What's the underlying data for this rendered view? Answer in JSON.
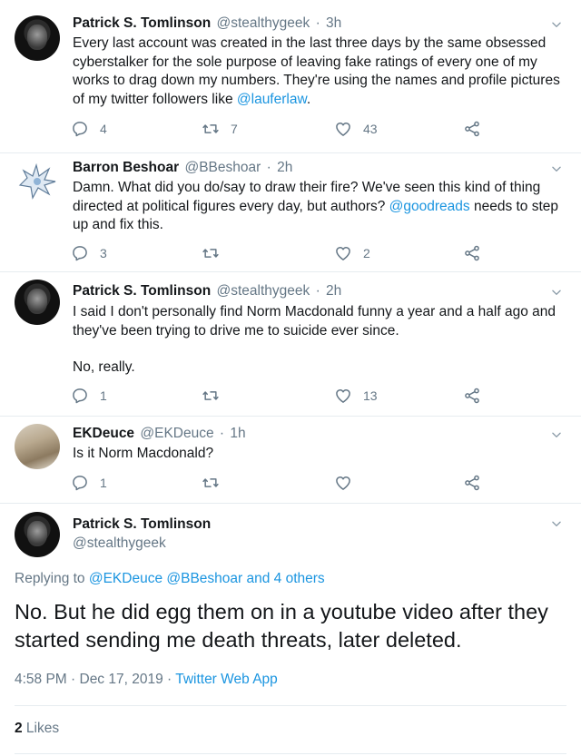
{
  "tweets": [
    {
      "name": "Patrick S. Tomlinson",
      "handle": "@stealthygeek",
      "time": "3h",
      "text_before": "Every last account was created in the last three days by the same obsessed cyberstalker for the sole purpose of leaving fake ratings of every one of my works to drag down my numbers. They're using the names and profile pictures of my twitter followers like ",
      "mention": "@lauferlaw",
      "text_after": ".",
      "replies": "4",
      "retweets": "7",
      "likes": "43"
    },
    {
      "name": "Barron Beshoar",
      "handle": "@BBeshoar",
      "time": "2h",
      "text_before": "Damn. What did you do/say to draw their fire? We've seen this kind of thing directed at political figures every day, but authors? ",
      "mention": "@goodreads",
      "text_after": " needs to step up and fix this.",
      "replies": "3",
      "retweets": "",
      "likes": "2"
    },
    {
      "name": "Patrick S. Tomlinson",
      "handle": "@stealthygeek",
      "time": "2h",
      "text_line1": "I said I don't personally find Norm Macdonald funny a year and a half ago and they've been trying to drive me to suicide ever since.",
      "text_line2": "No, really.",
      "replies": "1",
      "retweets": "",
      "likes": "13"
    },
    {
      "name": "EKDeuce",
      "handle": "@EKDeuce",
      "time": "1h",
      "text": "Is it Norm Macdonald?",
      "replies": "1",
      "retweets": "",
      "likes": ""
    }
  ],
  "main_tweet": {
    "name": "Patrick S. Tomlinson",
    "handle": "@stealthygeek",
    "replying_label": "Replying to",
    "replying_to": "@EKDeuce @BBeshoar and 4 others",
    "text": "No. But he did egg them on in a youtube video after they started sending me death threats, later deleted.",
    "timestamp": "4:58 PM · Dec 17, 2019 · ",
    "source": "Twitter Web App",
    "likes_count": "2",
    "likes_label": " Likes"
  },
  "colors": {
    "accent": "#1b95e0",
    "secondary_text": "#657786",
    "divider": "#e6ecf0"
  },
  "icons": [
    "chevron-down-icon",
    "reply-icon",
    "retweet-icon",
    "heart-icon",
    "share-icon"
  ]
}
